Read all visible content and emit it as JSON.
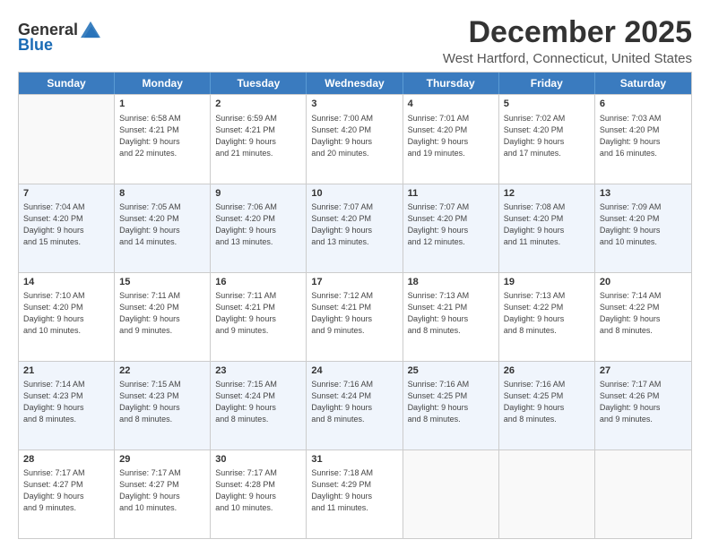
{
  "logo": {
    "general": "General",
    "blue": "Blue"
  },
  "title": "December 2025",
  "location": "West Hartford, Connecticut, United States",
  "days_of_week": [
    "Sunday",
    "Monday",
    "Tuesday",
    "Wednesday",
    "Thursday",
    "Friday",
    "Saturday"
  ],
  "weeks": [
    [
      {
        "day": "",
        "info": ""
      },
      {
        "day": "1",
        "info": "Sunrise: 6:58 AM\nSunset: 4:21 PM\nDaylight: 9 hours\nand 22 minutes."
      },
      {
        "day": "2",
        "info": "Sunrise: 6:59 AM\nSunset: 4:21 PM\nDaylight: 9 hours\nand 21 minutes."
      },
      {
        "day": "3",
        "info": "Sunrise: 7:00 AM\nSunset: 4:20 PM\nDaylight: 9 hours\nand 20 minutes."
      },
      {
        "day": "4",
        "info": "Sunrise: 7:01 AM\nSunset: 4:20 PM\nDaylight: 9 hours\nand 19 minutes."
      },
      {
        "day": "5",
        "info": "Sunrise: 7:02 AM\nSunset: 4:20 PM\nDaylight: 9 hours\nand 17 minutes."
      },
      {
        "day": "6",
        "info": "Sunrise: 7:03 AM\nSunset: 4:20 PM\nDaylight: 9 hours\nand 16 minutes."
      }
    ],
    [
      {
        "day": "7",
        "info": "Sunrise: 7:04 AM\nSunset: 4:20 PM\nDaylight: 9 hours\nand 15 minutes."
      },
      {
        "day": "8",
        "info": "Sunrise: 7:05 AM\nSunset: 4:20 PM\nDaylight: 9 hours\nand 14 minutes."
      },
      {
        "day": "9",
        "info": "Sunrise: 7:06 AM\nSunset: 4:20 PM\nDaylight: 9 hours\nand 13 minutes."
      },
      {
        "day": "10",
        "info": "Sunrise: 7:07 AM\nSunset: 4:20 PM\nDaylight: 9 hours\nand 13 minutes."
      },
      {
        "day": "11",
        "info": "Sunrise: 7:07 AM\nSunset: 4:20 PM\nDaylight: 9 hours\nand 12 minutes."
      },
      {
        "day": "12",
        "info": "Sunrise: 7:08 AM\nSunset: 4:20 PM\nDaylight: 9 hours\nand 11 minutes."
      },
      {
        "day": "13",
        "info": "Sunrise: 7:09 AM\nSunset: 4:20 PM\nDaylight: 9 hours\nand 10 minutes."
      }
    ],
    [
      {
        "day": "14",
        "info": "Sunrise: 7:10 AM\nSunset: 4:20 PM\nDaylight: 9 hours\nand 10 minutes."
      },
      {
        "day": "15",
        "info": "Sunrise: 7:11 AM\nSunset: 4:20 PM\nDaylight: 9 hours\nand 9 minutes."
      },
      {
        "day": "16",
        "info": "Sunrise: 7:11 AM\nSunset: 4:21 PM\nDaylight: 9 hours\nand 9 minutes."
      },
      {
        "day": "17",
        "info": "Sunrise: 7:12 AM\nSunset: 4:21 PM\nDaylight: 9 hours\nand 9 minutes."
      },
      {
        "day": "18",
        "info": "Sunrise: 7:13 AM\nSunset: 4:21 PM\nDaylight: 9 hours\nand 8 minutes."
      },
      {
        "day": "19",
        "info": "Sunrise: 7:13 AM\nSunset: 4:22 PM\nDaylight: 9 hours\nand 8 minutes."
      },
      {
        "day": "20",
        "info": "Sunrise: 7:14 AM\nSunset: 4:22 PM\nDaylight: 9 hours\nand 8 minutes."
      }
    ],
    [
      {
        "day": "21",
        "info": "Sunrise: 7:14 AM\nSunset: 4:23 PM\nDaylight: 9 hours\nand 8 minutes."
      },
      {
        "day": "22",
        "info": "Sunrise: 7:15 AM\nSunset: 4:23 PM\nDaylight: 9 hours\nand 8 minutes."
      },
      {
        "day": "23",
        "info": "Sunrise: 7:15 AM\nSunset: 4:24 PM\nDaylight: 9 hours\nand 8 minutes."
      },
      {
        "day": "24",
        "info": "Sunrise: 7:16 AM\nSunset: 4:24 PM\nDaylight: 9 hours\nand 8 minutes."
      },
      {
        "day": "25",
        "info": "Sunrise: 7:16 AM\nSunset: 4:25 PM\nDaylight: 9 hours\nand 8 minutes."
      },
      {
        "day": "26",
        "info": "Sunrise: 7:16 AM\nSunset: 4:25 PM\nDaylight: 9 hours\nand 8 minutes."
      },
      {
        "day": "27",
        "info": "Sunrise: 7:17 AM\nSunset: 4:26 PM\nDaylight: 9 hours\nand 9 minutes."
      }
    ],
    [
      {
        "day": "28",
        "info": "Sunrise: 7:17 AM\nSunset: 4:27 PM\nDaylight: 9 hours\nand 9 minutes."
      },
      {
        "day": "29",
        "info": "Sunrise: 7:17 AM\nSunset: 4:27 PM\nDaylight: 9 hours\nand 10 minutes."
      },
      {
        "day": "30",
        "info": "Sunrise: 7:17 AM\nSunset: 4:28 PM\nDaylight: 9 hours\nand 10 minutes."
      },
      {
        "day": "31",
        "info": "Sunrise: 7:18 AM\nSunset: 4:29 PM\nDaylight: 9 hours\nand 11 minutes."
      },
      {
        "day": "",
        "info": ""
      },
      {
        "day": "",
        "info": ""
      },
      {
        "day": "",
        "info": ""
      }
    ]
  ],
  "colors": {
    "header_bg": "#3a7bbf",
    "row_alt": "#f0f5fc",
    "row_normal": "#ffffff",
    "empty_cell": "#f9f9f9"
  }
}
